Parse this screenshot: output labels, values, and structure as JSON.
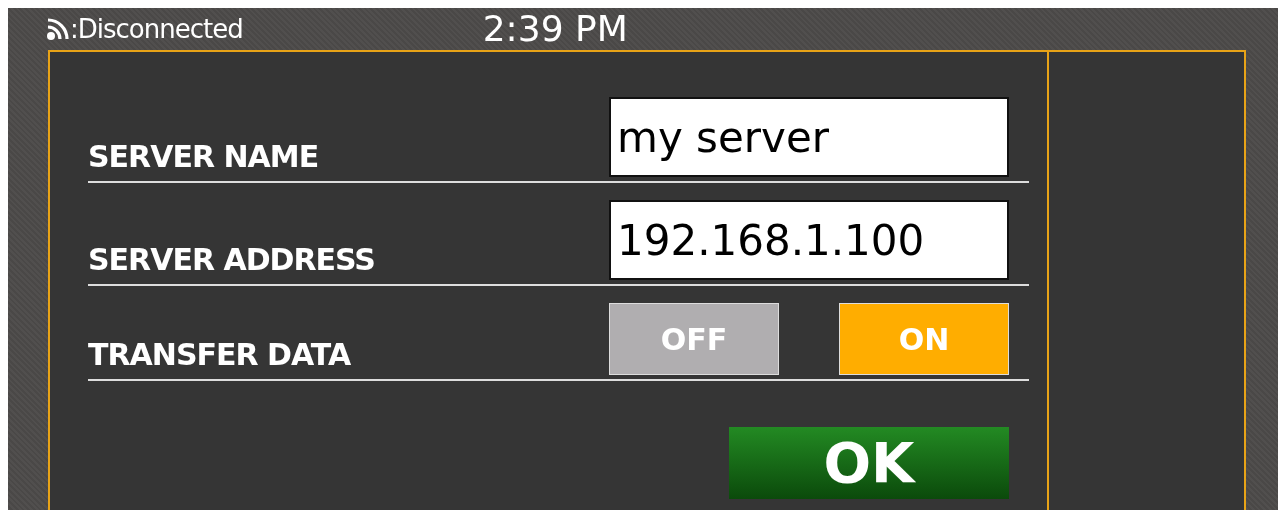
{
  "status_bar": {
    "connection": ":Disconnected",
    "time": "2:39 PM"
  },
  "form": {
    "rows": [
      {
        "kind": "field",
        "label": "SERVER NAME",
        "value": "my server"
      },
      {
        "kind": "field",
        "label": "SERVER ADDRESS",
        "value": "192.168.1.100"
      },
      {
        "kind": "toggle",
        "label": "TRANSFER DATA",
        "options": [
          {
            "label": "OFF",
            "selected": false
          },
          {
            "label": "ON",
            "selected": true
          }
        ]
      }
    ],
    "ok_button": "OK"
  }
}
